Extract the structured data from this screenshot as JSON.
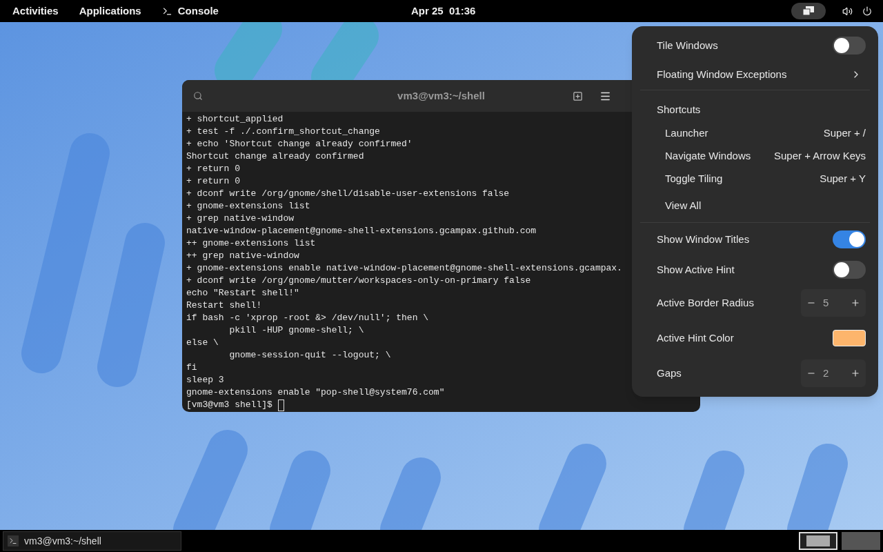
{
  "top_bar": {
    "activities": "Activities",
    "applications": "Applications",
    "app_name": "Console",
    "clock": "Apr 25  01:36"
  },
  "terminal": {
    "title": "vm3@vm3:~/shell",
    "lines": [
      "+ shortcut_applied",
      "+ test -f ./.confirm_shortcut_change",
      "+ echo 'Shortcut change already confirmed'",
      "Shortcut change already confirmed",
      "+ return 0",
      "+ return 0",
      "+ dconf write /org/gnome/shell/disable-user-extensions false",
      "+ gnome-extensions list",
      "+ grep native-window",
      "native-window-placement@gnome-shell-extensions.gcampax.github.com",
      "++ gnome-extensions list",
      "++ grep native-window",
      "+ gnome-extensions enable native-window-placement@gnome-shell-extensions.gcampax.",
      "+ dconf write /org/gnome/mutter/workspaces-only-on-primary false",
      "echo \"Restart shell!\"",
      "Restart shell!",
      "if bash -c 'xprop -root &> /dev/null'; then \\",
      "        pkill -HUP gnome-shell; \\",
      "else \\",
      "        gnome-session-quit --logout; \\",
      "fi",
      "sleep 3",
      "gnome-extensions enable \"pop-shell@system76.com\""
    ],
    "prompt": "[vm3@vm3 shell]$ "
  },
  "menu": {
    "sections": [
      [
        {
          "kind": "toggle",
          "label": "Tile Windows",
          "on": false
        },
        {
          "kind": "submenu",
          "label": "Floating Window Exceptions"
        }
      ],
      [
        {
          "kind": "header",
          "label": "Shortcuts"
        },
        {
          "kind": "shortcut",
          "label": "Launcher",
          "keys": "Super + /"
        },
        {
          "kind": "shortcut",
          "label": "Navigate Windows",
          "keys": "Super + Arrow Keys"
        },
        {
          "kind": "shortcut",
          "label": "Toggle Tiling",
          "keys": "Super + Y"
        },
        {
          "kind": "link",
          "label": "View All"
        }
      ],
      [
        {
          "kind": "toggle",
          "label": "Show Window Titles",
          "on": true
        },
        {
          "kind": "toggle",
          "label": "Show Active Hint",
          "on": false
        },
        {
          "kind": "spinner",
          "label": "Active Border Radius",
          "value": "5"
        },
        {
          "kind": "color",
          "label": "Active Hint Color",
          "color": "#fdb56c"
        },
        {
          "kind": "spinner",
          "label": "Gaps",
          "value": "2"
        }
      ]
    ]
  },
  "taskbar": {
    "window_title": "vm3@vm3:~/shell",
    "workspaces": [
      {
        "selected": true
      },
      {
        "selected": false
      }
    ]
  }
}
